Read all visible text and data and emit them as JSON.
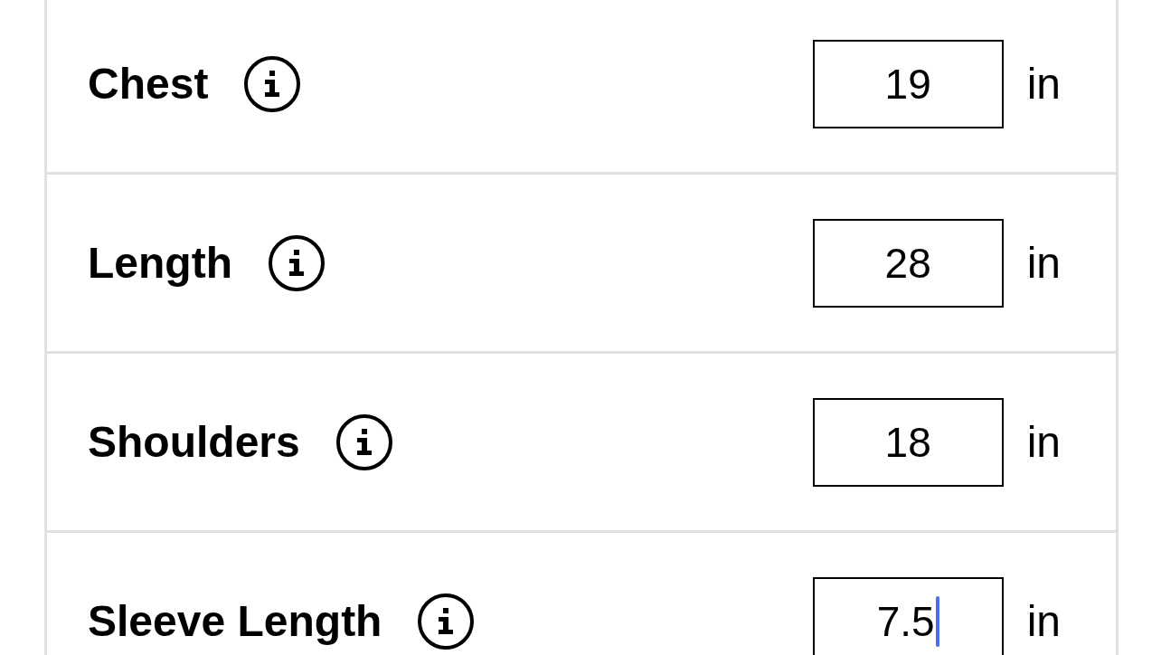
{
  "measurements": [
    {
      "label": "Chest",
      "value": "19",
      "unit": "in",
      "focused": false
    },
    {
      "label": "Length",
      "value": "28",
      "unit": "in",
      "focused": false
    },
    {
      "label": "Shoulders",
      "value": "18",
      "unit": "in",
      "focused": false
    },
    {
      "label": "Sleeve Length",
      "value": "7.5",
      "unit": "in",
      "focused": true
    }
  ]
}
